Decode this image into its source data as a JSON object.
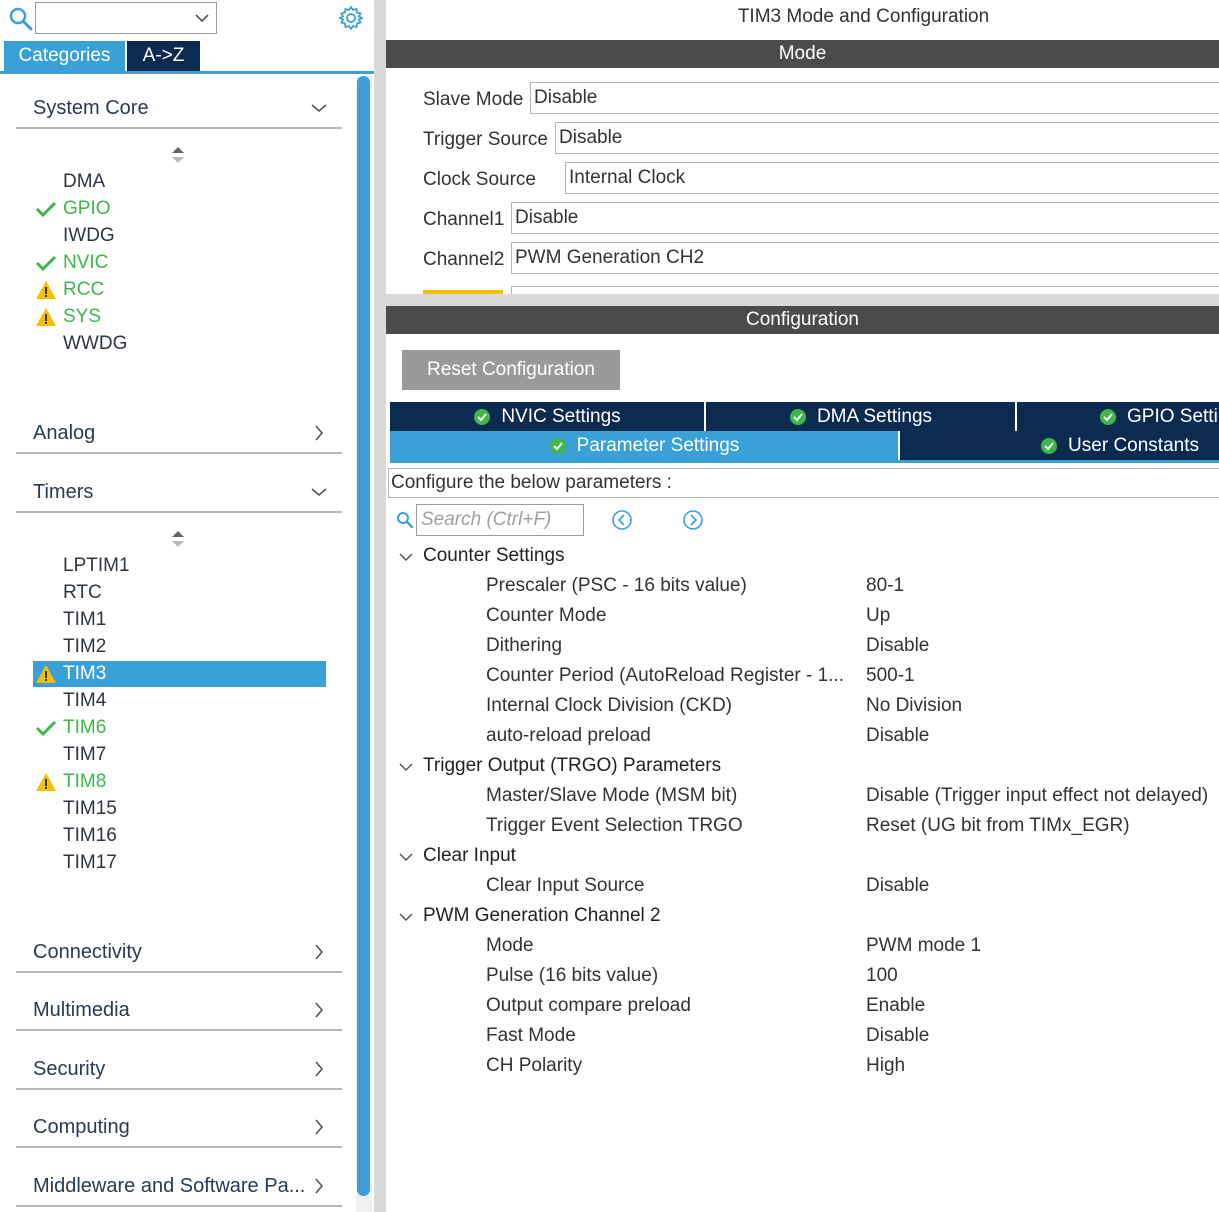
{
  "search": {
    "value": ""
  },
  "left_tabs": {
    "categories": "Categories",
    "az": "A->Z"
  },
  "categories": {
    "system_core": {
      "label": "System Core",
      "items": [
        {
          "name": "DMA",
          "status": "none"
        },
        {
          "name": "GPIO",
          "status": "ok"
        },
        {
          "name": "IWDG",
          "status": "none"
        },
        {
          "name": "NVIC",
          "status": "ok"
        },
        {
          "name": "RCC",
          "status": "warning"
        },
        {
          "name": "SYS",
          "status": "warning"
        },
        {
          "name": "WWDG",
          "status": "none"
        }
      ]
    },
    "analog": {
      "label": "Analog"
    },
    "timers": {
      "label": "Timers",
      "items": [
        {
          "name": "LPTIM1",
          "status": "none"
        },
        {
          "name": "RTC",
          "status": "none"
        },
        {
          "name": "TIM1",
          "status": "none"
        },
        {
          "name": "TIM2",
          "status": "none"
        },
        {
          "name": "TIM3",
          "status": "warning",
          "selected": true
        },
        {
          "name": "TIM4",
          "status": "none"
        },
        {
          "name": "TIM6",
          "status": "ok"
        },
        {
          "name": "TIM7",
          "status": "none"
        },
        {
          "name": "TIM8",
          "status": "warning"
        },
        {
          "name": "TIM15",
          "status": "none"
        },
        {
          "name": "TIM16",
          "status": "none"
        },
        {
          "name": "TIM17",
          "status": "none"
        }
      ]
    },
    "connectivity": {
      "label": "Connectivity"
    },
    "multimedia": {
      "label": "Multimedia"
    },
    "security": {
      "label": "Security"
    },
    "computing": {
      "label": "Computing"
    },
    "middleware": {
      "label": "Middleware and Software Pa..."
    }
  },
  "right": {
    "title": "TIM3 Mode and Configuration",
    "mode_header": "Mode",
    "mode_rows": [
      {
        "label": "Slave Mode",
        "value": "Disable"
      },
      {
        "label": "Trigger Source",
        "value": "Disable"
      },
      {
        "label": "Clock Source",
        "value": "Internal Clock"
      },
      {
        "label": "Channel1",
        "value": "Disable"
      },
      {
        "label": "Channel2",
        "value": "PWM Generation CH2"
      }
    ],
    "config_header": "Configuration",
    "reset_button": "Reset Configuration",
    "tabs": {
      "nvic": "NVIC Settings",
      "dma": "DMA Settings",
      "gpio": "GPIO Settings",
      "parameter": "Parameter Settings",
      "user": "User Constants"
    },
    "config_desc": "Configure the below parameters :",
    "param_search_placeholder": "Search (Ctrl+F)",
    "groups": [
      {
        "title": "Counter Settings",
        "params": [
          {
            "name": "Prescaler (PSC - 16 bits value)",
            "value": "80-1"
          },
          {
            "name": "Counter Mode",
            "value": "Up"
          },
          {
            "name": "Dithering",
            "value": "Disable"
          },
          {
            "name": "Counter Period (AutoReload Register - 1...",
            "value": "500-1"
          },
          {
            "name": "Internal Clock Division (CKD)",
            "value": "No Division"
          },
          {
            "name": "auto-reload preload",
            "value": "Disable"
          }
        ]
      },
      {
        "title": "Trigger Output (TRGO) Parameters",
        "params": [
          {
            "name": "Master/Slave Mode (MSM bit)",
            "value": "Disable (Trigger input effect not delayed)"
          },
          {
            "name": "Trigger Event Selection TRGO",
            "value": "Reset (UG bit from TIMx_EGR)"
          }
        ]
      },
      {
        "title": "Clear Input",
        "params": [
          {
            "name": "Clear Input Source",
            "value": "Disable"
          }
        ]
      },
      {
        "title": "PWM Generation Channel 2",
        "params": [
          {
            "name": "Mode",
            "value": "PWM mode 1"
          },
          {
            "name": "Pulse (16 bits value)",
            "value": "100"
          },
          {
            "name": "Output compare preload",
            "value": "Enable"
          },
          {
            "name": "Fast Mode",
            "value": "Disable"
          },
          {
            "name": "CH Polarity",
            "value": "High"
          }
        ]
      }
    ]
  },
  "colors": {
    "accent": "#3aa0d8",
    "navy": "#0a2a50",
    "ok": "#3fb54a",
    "warning": "#f5c000",
    "header_bar": "#4b4b4b"
  },
  "icons": {
    "search": "search-icon",
    "settings": "gear-icon",
    "ok": "check-icon",
    "warning": "warning-icon",
    "expand": "chevron-down-icon",
    "collapsed": "chevron-right-icon",
    "sort": "sort-icon",
    "prev": "prev-match-icon",
    "next": "next-match-icon"
  }
}
